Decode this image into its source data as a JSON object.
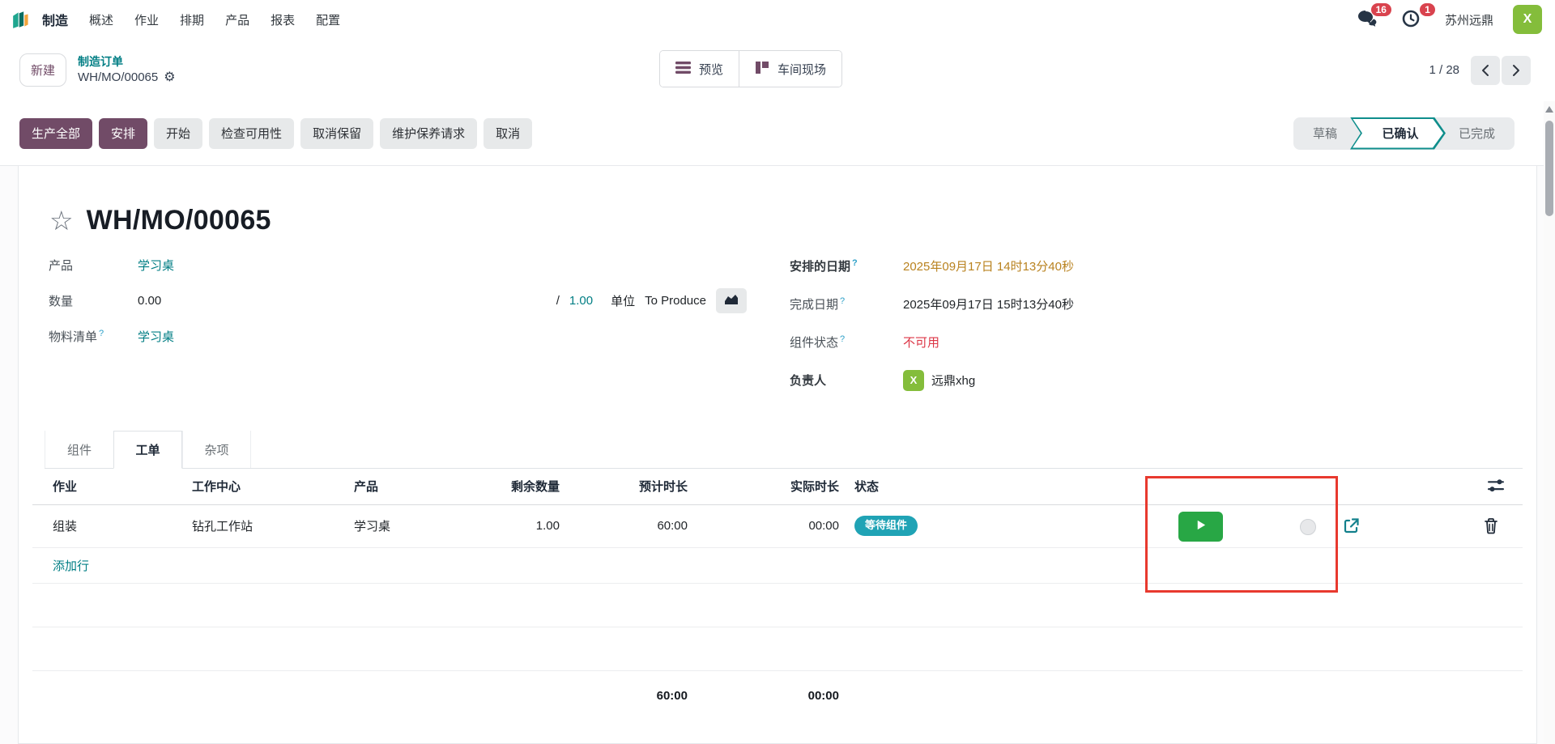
{
  "nav": {
    "app_name": "制造",
    "items": [
      "概述",
      "作业",
      "排期",
      "产品",
      "报表",
      "配置"
    ],
    "messages_badge": "16",
    "activities_badge": "1",
    "company_name": "苏州远鼎",
    "user_initial": "X"
  },
  "control_panel": {
    "new_button": "新建",
    "breadcrumb_parent": "制造订单",
    "breadcrumb_current": "WH/MO/00065",
    "view_switcher": [
      "预览",
      "车间现场"
    ],
    "pager_value": "1 / 28"
  },
  "action_bar": {
    "buttons_primary": [
      "生产全部",
      "安排"
    ],
    "buttons_secondary": [
      "开始",
      "检查可用性",
      "取消保留",
      "维护保养请求",
      "取消"
    ],
    "status_steps": [
      "草稿",
      "已确认",
      "已完成"
    ],
    "active_step": "已确认"
  },
  "form": {
    "title": "WH/MO/00065",
    "left_fields": [
      {
        "label": "产品",
        "value": "学习桌"
      },
      {
        "label": "数量",
        "value": "0.00",
        "slash": "/",
        "total": "1.00",
        "uom_label": "单位",
        "uom_value": "To Produce"
      },
      {
        "label": "物料清单",
        "help": "?",
        "value": "学习桌"
      }
    ],
    "right_fields": [
      {
        "label": "安排的日期",
        "help": "?",
        "value": "2025年09月17日 14时13分40秒"
      },
      {
        "label": "完成日期",
        "help": "?",
        "value": "2025年09月17日 15时13分40秒"
      },
      {
        "label": "组件状态",
        "help": "?",
        "value": "不可用"
      },
      {
        "label": "负责人",
        "avatar": "X",
        "value": "远鼎xhg"
      }
    ],
    "tabs": [
      "组件",
      "工单",
      "杂项"
    ],
    "active_tab": "工单"
  },
  "workorders": {
    "columns": [
      "作业",
      "工作中心",
      "产品",
      "剩余数量",
      "预计时长",
      "实际时长",
      "状态"
    ],
    "row": {
      "operation": "组装",
      "workcenter": "钻孔工作站",
      "product": "学习桌",
      "remaining": "1.00",
      "expected": "60:00",
      "real": "00:00",
      "status": "等待组件"
    },
    "add_line_label": "添加行",
    "totals": {
      "expected": "60:00",
      "real": "00:00"
    }
  },
  "icons": {
    "logo": "app-logo",
    "messages": "chat-bubble-icon",
    "activities": "clock-icon",
    "settings_gear": "gear-icon",
    "favorite": "star-icon",
    "quantity_forecast": "area-chart-icon",
    "list_view": "list-icon",
    "shopfloor_view": "kanban-icon",
    "row_play": "play-icon",
    "row_open": "external-link-icon",
    "row_delete": "trash-icon",
    "optional_columns": "sliders-icon"
  },
  "colors": {
    "primary": "#714B67",
    "link_teal": "#017e84",
    "status_badge": "#20a3b5",
    "scheduled_date": "#b9821f",
    "danger": "#dc3545",
    "play_green": "#28a745",
    "avatar_green": "#84bd3b",
    "annotation_red": "#e8392e",
    "badge_red": "#d9434e"
  }
}
